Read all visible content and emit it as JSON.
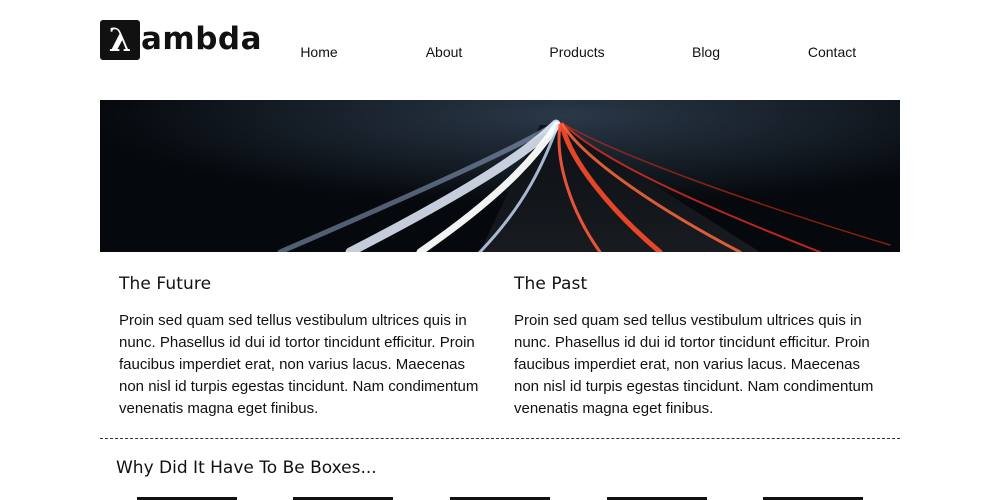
{
  "header": {
    "logo_symbol": "λ",
    "logo_text": "ambda",
    "nav": [
      "Home",
      "About",
      "Products",
      "Blog",
      "Contact"
    ]
  },
  "hero": {
    "image": "night-highway-light-trails"
  },
  "columns": [
    {
      "title": "The Future",
      "body": "Proin sed quam sed tellus vestibulum ultrices quis in nunc. Phasellus id dui id tortor tincidunt efficitur. Proin faucibus imperdiet erat, non varius lacus. Maecenas non nisl id turpis egestas tincidunt. Nam condimentum venenatis magna eget finibus."
    },
    {
      "title": "The Past",
      "body": "Proin sed quam sed tellus vestibulum ultrices quis in nunc. Phasellus id dui id tortor tincidunt efficitur. Proin faucibus imperdiet erat, non varius lacus. Maecenas non nisl id turpis egestas tincidunt. Nam condimentum venenatis magna eget finibus."
    }
  ],
  "boxes_section": {
    "title": "Why Did It Have To Be Boxes..."
  },
  "colors": {
    "text": "#111111",
    "background": "#ffffff",
    "hero_bg": "#05080c",
    "trail_white": "#e8f0ff",
    "trail_red": "#ff4a2a"
  }
}
